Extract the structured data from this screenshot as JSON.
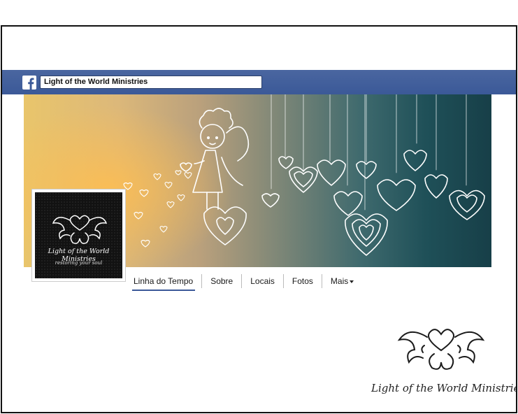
{
  "facebook_bar": {
    "logo_icon": "facebook-f-icon",
    "search_value": "Light of the World Ministries",
    "color": "#3b5998"
  },
  "profile": {
    "name": "Light of the World Ministries",
    "tagline": "restoring your soul"
  },
  "tabs": [
    {
      "label": "Linha do Tempo",
      "active": true
    },
    {
      "label": "Sobre"
    },
    {
      "label": "Locais"
    },
    {
      "label": "Fotos"
    },
    {
      "label": "Mais"
    }
  ],
  "brand": {
    "name": "Light of the World Ministries"
  }
}
